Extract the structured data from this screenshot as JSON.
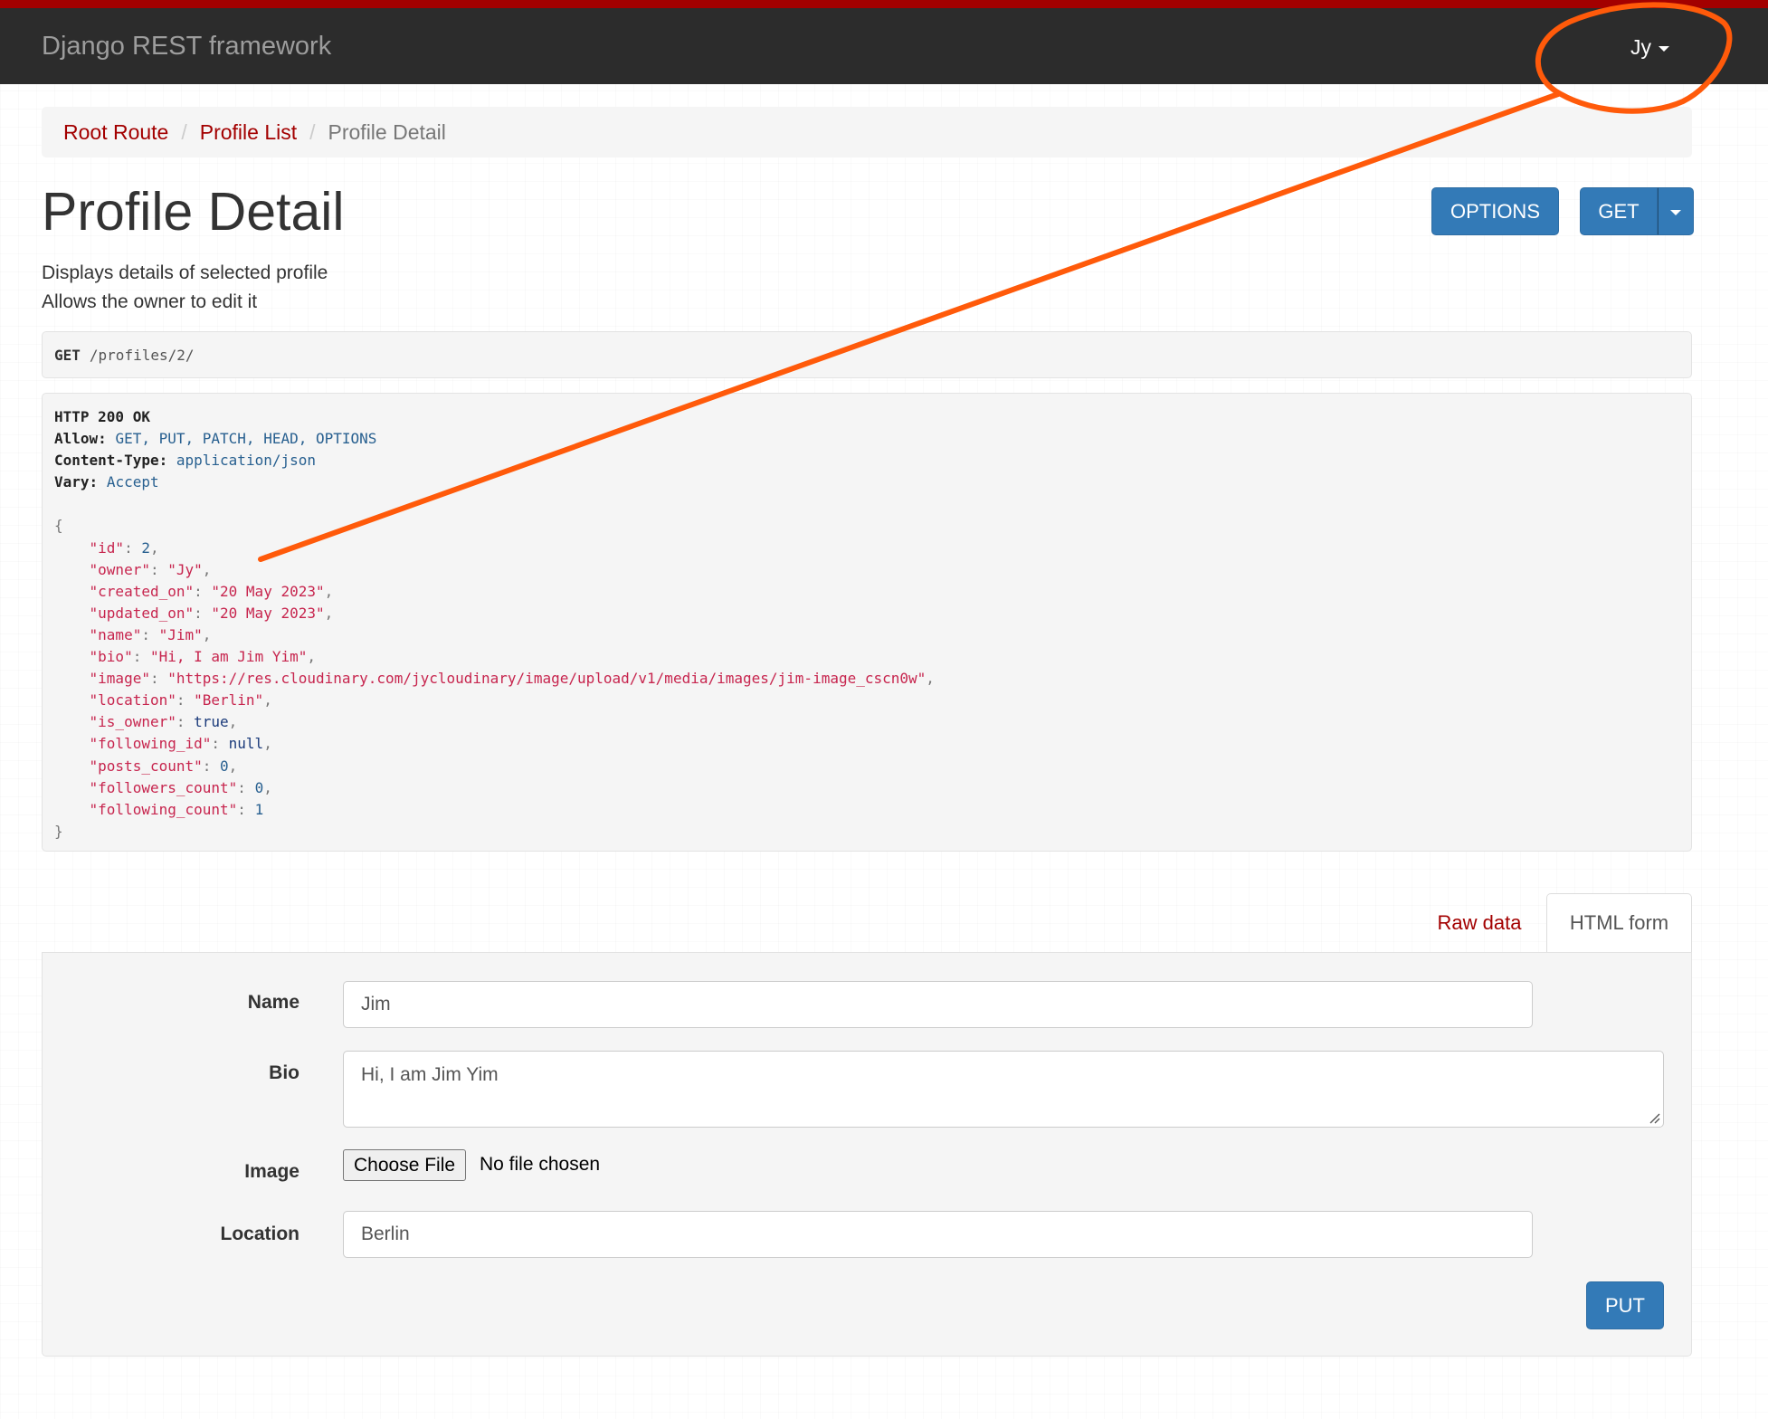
{
  "navbar": {
    "brand": "Django REST framework",
    "user": "Jy"
  },
  "breadcrumb": {
    "items": [
      "Root Route",
      "Profile List",
      "Profile Detail"
    ],
    "separator": "/"
  },
  "page": {
    "title": "Profile Detail",
    "description": [
      "Displays details of selected profile",
      "Allows the owner to edit it"
    ]
  },
  "buttons": {
    "options": "OPTIONS",
    "get": "GET",
    "put": "PUT"
  },
  "request": {
    "method": "GET",
    "path": "/profiles/2/"
  },
  "response": {
    "status": "HTTP 200 OK",
    "headers": [
      {
        "name": "Allow:",
        "value": "GET, PUT, PATCH, HEAD, OPTIONS"
      },
      {
        "name": "Content-Type:",
        "value": "application/json"
      },
      {
        "name": "Vary:",
        "value": "Accept"
      }
    ],
    "json": {
      "id": "2",
      "owner": "\"Jy\"",
      "created_on": "\"20 May 2023\"",
      "updated_on": "\"20 May 2023\"",
      "name": "\"Jim\"",
      "bio": "\"Hi, I am Jim Yim\"",
      "image": "\"https://res.cloudinary.com/jycloudinary/image/upload/v1/media/images/jim-image_cscn0w\"",
      "location": "\"Berlin\"",
      "is_owner": "true",
      "following_id": "null",
      "posts_count": "0",
      "followers_count": "0",
      "following_count": "1"
    }
  },
  "tabs": {
    "raw": "Raw data",
    "html": "HTML form"
  },
  "form": {
    "name_label": "Name",
    "name_value": "Jim",
    "bio_label": "Bio",
    "bio_value": "Hi, I am Jim Yim",
    "image_label": "Image",
    "file_button": "Choose File",
    "file_status": "No file chosen",
    "location_label": "Location",
    "location_value": "Berlin"
  },
  "colors": {
    "navbar": "#2c2c2c",
    "navbar_accent": "#a30000",
    "link": "#a30000",
    "primary": "#337ab7",
    "annotation": "#ff5a0a"
  }
}
